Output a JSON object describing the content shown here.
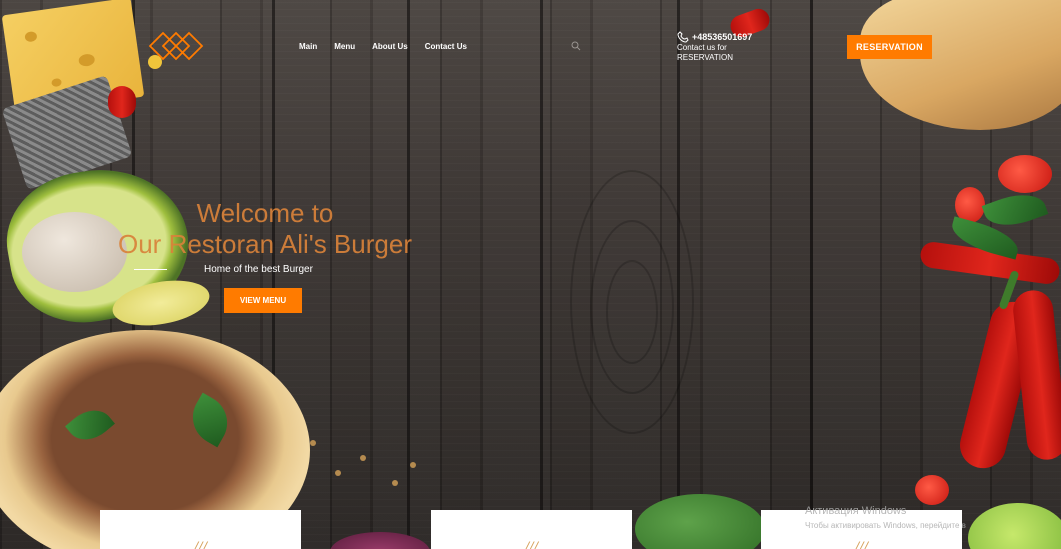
{
  "nav": {
    "items": [
      {
        "label": "Main"
      },
      {
        "label": "Menu"
      },
      {
        "label": "About Us"
      },
      {
        "label": "Contact Us"
      }
    ]
  },
  "contact": {
    "phone": "+48536501697",
    "line1": "Contact us for",
    "line2": "RESERVATION"
  },
  "header": {
    "reserve_label": "RESERVATION"
  },
  "hero": {
    "title_line1": "Welcome to",
    "title_line2": "Our Restoran Ali's Burger",
    "subtitle": "Home of the best Burger",
    "button_label": "VIEW MENU"
  },
  "cards": [
    {
      "icon": "///"
    },
    {
      "icon": "///"
    },
    {
      "icon": "///"
    }
  ],
  "activation": {
    "title": "Активация Windows",
    "text": "Чтобы активировать Windows, перейдите в"
  },
  "colors": {
    "accent": "#ff7b00",
    "hero_title": "#d9823a"
  }
}
